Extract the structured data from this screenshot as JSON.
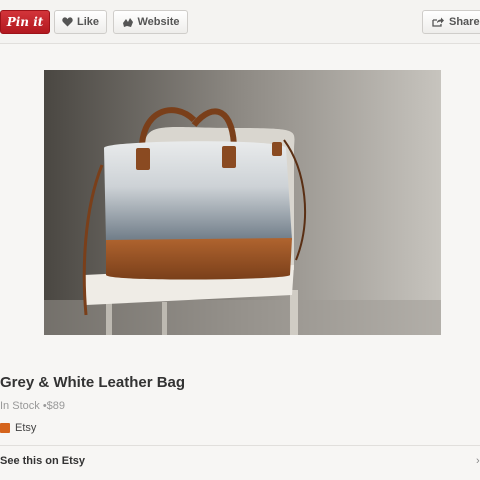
{
  "toolbar": {
    "pin_label": "Pin it",
    "like_label": "Like",
    "website_label": "Website",
    "share_label": "Share"
  },
  "product": {
    "title": "Grey & White Leather Bag",
    "availability": "In Stock",
    "price": "$89",
    "source_name": "Etsy"
  },
  "link": {
    "see_label": "See this on Etsy",
    "chevron": "›"
  },
  "icons": {
    "like": "heart-icon",
    "website": "globe-icon",
    "share": "share-arrow-icon",
    "source": "etsy-icon"
  },
  "colors": {
    "pin_red": "#c8232c",
    "etsy_orange": "#d5641c"
  }
}
